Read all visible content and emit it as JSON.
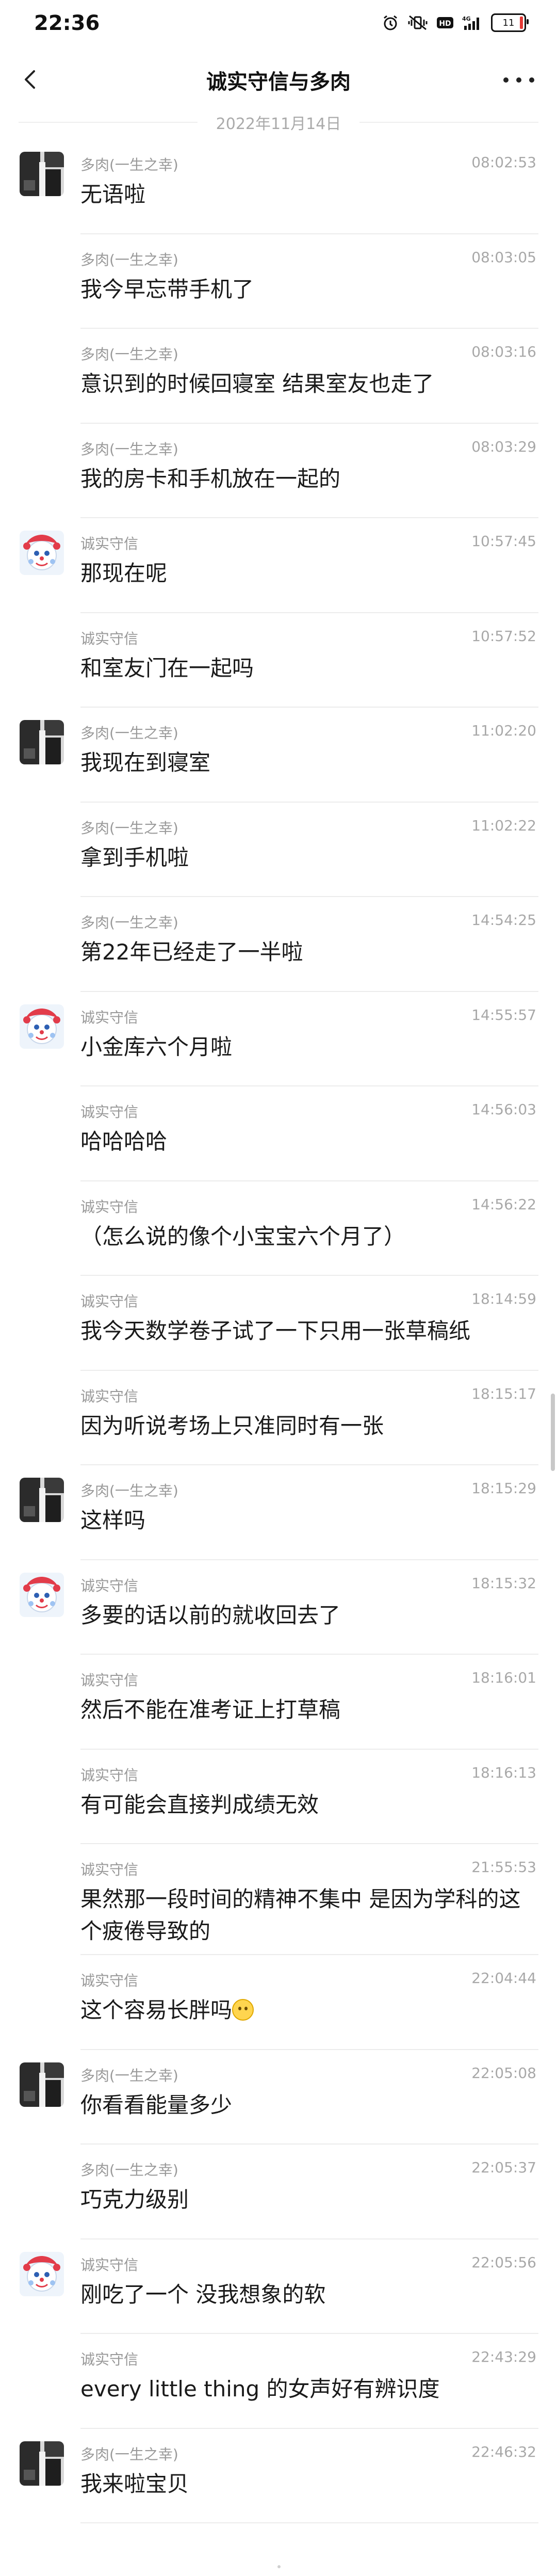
{
  "status_bar": {
    "time": "22:36",
    "signal_label": "4G",
    "hd_label": "HD",
    "battery_level": "11"
  },
  "nav": {
    "title": "诚实守信与多肉"
  },
  "date_divider": "2022年11月14日",
  "colors": {
    "timestamp": "#a8a8a8",
    "sender": "#999999",
    "divider": "#ececec"
  },
  "messages": [
    {
      "sender": "多肉(一生之幸)",
      "time": "08:02:53",
      "text": "无语啦",
      "avatar": "duorou"
    },
    {
      "sender": "多肉(一生之幸)",
      "time": "08:03:05",
      "text": "我今早忘带手机了",
      "avatar": ""
    },
    {
      "sender": "多肉(一生之幸)",
      "time": "08:03:16",
      "text": "意识到的时候回寝室 结果室友也走了",
      "avatar": ""
    },
    {
      "sender": "多肉(一生之幸)",
      "time": "08:03:29",
      "text": "我的房卡和手机放在一起的",
      "avatar": ""
    },
    {
      "sender": "诚实守信",
      "time": "10:57:45",
      "text": "那现在呢",
      "avatar": "chengshi"
    },
    {
      "sender": "诚实守信",
      "time": "10:57:52",
      "text": "和室友门在一起吗",
      "avatar": ""
    },
    {
      "sender": "多肉(一生之幸)",
      "time": "11:02:20",
      "text": "我现在到寝室",
      "avatar": "duorou"
    },
    {
      "sender": "多肉(一生之幸)",
      "time": "11:02:22",
      "text": "拿到手机啦",
      "avatar": ""
    },
    {
      "sender": "多肉(一生之幸)",
      "time": "14:54:25",
      "text": "第22年已经走了一半啦",
      "avatar": ""
    },
    {
      "sender": "诚实守信",
      "time": "14:55:57",
      "text": "小金库六个月啦",
      "avatar": "chengshi"
    },
    {
      "sender": "诚实守信",
      "time": "14:56:03",
      "text": "哈哈哈哈",
      "avatar": ""
    },
    {
      "sender": "诚实守信",
      "time": "14:56:22",
      "text": "（怎么说的像个小宝宝六个月了）",
      "avatar": ""
    },
    {
      "sender": "诚实守信",
      "time": "18:14:59",
      "text": "我今天数学卷子试了一下只用一张草稿纸",
      "avatar": ""
    },
    {
      "sender": "诚实守信",
      "time": "18:15:17",
      "text": "因为听说考场上只准同时有一张",
      "avatar": ""
    },
    {
      "sender": "多肉(一生之幸)",
      "time": "18:15:29",
      "text": "这样吗",
      "avatar": "duorou"
    },
    {
      "sender": "诚实守信",
      "time": "18:15:32",
      "text": "多要的话以前的就收回去了",
      "avatar": "chengshi"
    },
    {
      "sender": "诚实守信",
      "time": "18:16:01",
      "text": "然后不能在准考证上打草稿",
      "avatar": ""
    },
    {
      "sender": "诚实守信",
      "time": "18:16:13",
      "text": "有可能会直接判成绩无效",
      "avatar": ""
    },
    {
      "sender": "诚实守信",
      "time": "21:55:53",
      "text": "果然那一段时间的精神不集中 是因为学科的这个疲倦导致的",
      "avatar": "",
      "tall": true
    },
    {
      "sender": "诚实守信",
      "time": "22:04:44",
      "text": "这个容易长胖吗",
      "avatar": "",
      "emoji": "flushed-face"
    },
    {
      "sender": "多肉(一生之幸)",
      "time": "22:05:08",
      "text": "你看看能量多少",
      "avatar": "duorou"
    },
    {
      "sender": "多肉(一生之幸)",
      "time": "22:05:37",
      "text": "巧克力级别",
      "avatar": ""
    },
    {
      "sender": "诚实守信",
      "time": "22:05:56",
      "text": "刚吃了一个 没我想象的软",
      "avatar": "chengshi"
    },
    {
      "sender": "诚实守信",
      "time": "22:43:29",
      "text": "every little thing 的女声好有辨识度",
      "avatar": ""
    },
    {
      "sender": "多肉(一生之幸)",
      "time": "22:46:32",
      "text": "我来啦宝贝",
      "avatar": "duorou"
    }
  ]
}
